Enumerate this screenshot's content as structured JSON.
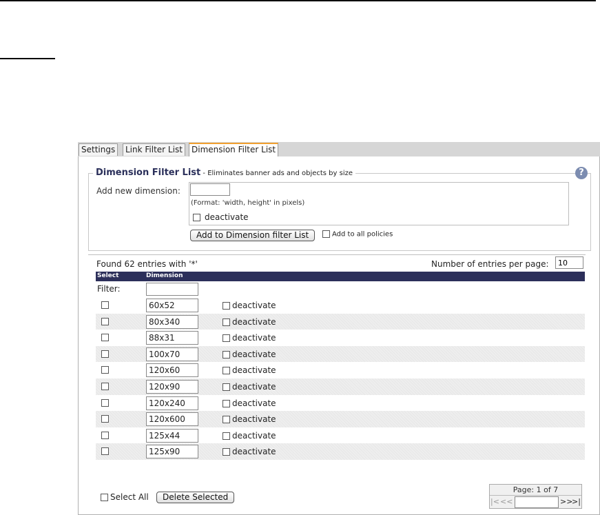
{
  "tabs": [
    "Settings",
    "Link Filter List",
    "Dimension Filter List"
  ],
  "section": {
    "title": "Dimension Filter List",
    "separator": " - ",
    "subtitle": "Eliminates banner ads and objects by size"
  },
  "add_form": {
    "label": "Add new dimension:",
    "input_value": "",
    "hint": "(Format: 'width, height' in pixels)",
    "deactivate_label": "deactivate",
    "add_button": "Add to Dimension filter List",
    "add_all_label": "Add to all policies"
  },
  "list": {
    "found_text": "Found 62 entries with '*'",
    "per_page_label": "Number of entries per page:",
    "per_page_value": "10",
    "col_select": "Select",
    "col_dimension": "Dimension",
    "filter_label": "Filter:",
    "deactivate_label": "deactivate",
    "rows": [
      "60x52",
      "80x340",
      "88x31",
      "100x70",
      "120x60",
      "120x90",
      "120x240",
      "120x600",
      "125x44",
      "125x90"
    ]
  },
  "footer": {
    "select_all": "Select All",
    "delete_button": "Delete Selected",
    "page_label": "Page: 1 of 7",
    "nav_first": "|<",
    "nav_prev": "<<",
    "nav_next": ">>",
    "nav_last": ">|"
  },
  "colors": {
    "header_bg": "#2c2f5a",
    "active_tab_accent": "#f0a030",
    "help_icon": "#7c8cb0"
  },
  "icons": {
    "help": "question-mark-icon"
  }
}
